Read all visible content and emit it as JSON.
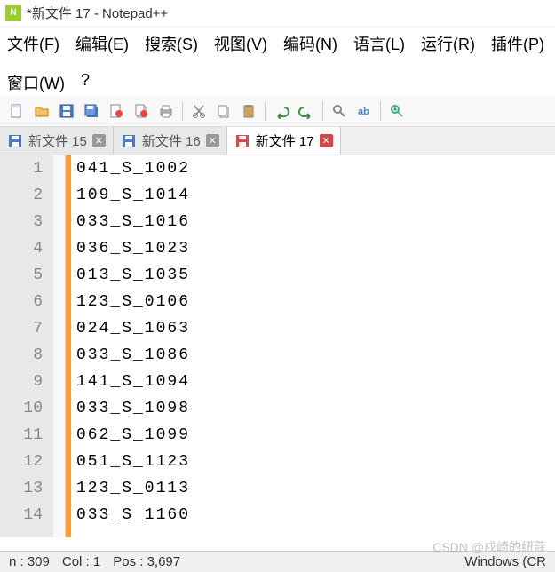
{
  "title": "*新文件 17 - Notepad++",
  "menus": {
    "file": "文件(F)",
    "edit": "编辑(E)",
    "search": "搜索(S)",
    "view": "视图(V)",
    "encoding": "编码(N)",
    "language": "语言(L)",
    "run": "运行(R)",
    "plugins": "插件(P)",
    "window": "窗口(W)",
    "help": "?"
  },
  "tabs": [
    {
      "label": "新文件 15",
      "active": false,
      "modified": false
    },
    {
      "label": "新文件 16",
      "active": false,
      "modified": false
    },
    {
      "label": "新文件 17",
      "active": true,
      "modified": true
    }
  ],
  "lines": [
    "041_S_1002",
    "109_S_1014",
    "033_S_1016",
    "036_S_1023",
    "013_S_1035",
    "123_S_0106",
    "024_S_1063",
    "033_S_1086",
    "141_S_1094",
    "033_S_1098",
    "062_S_1099",
    "051_S_1123",
    "123_S_0113",
    "033_S_1160"
  ],
  "status": {
    "ln": "n : 309",
    "col": "Col : 1",
    "pos": "Pos : 3,697",
    "enc": "Windows (CR"
  },
  "watermark": "CSDN @戍崎的纽蔻"
}
